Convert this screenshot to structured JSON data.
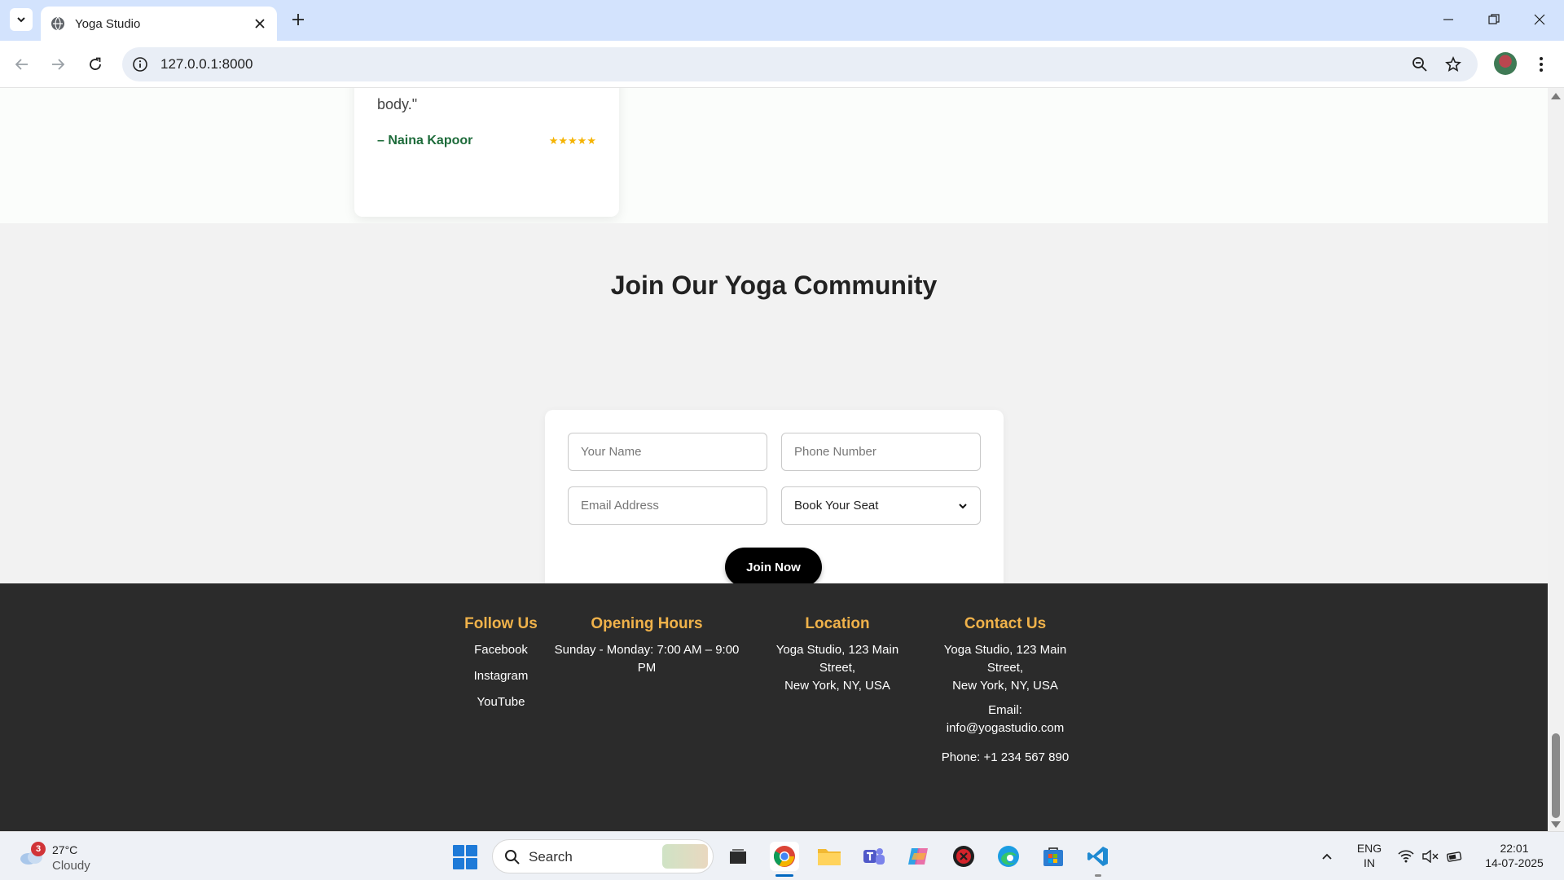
{
  "browser": {
    "tab_title": "Yoga Studio",
    "url": "127.0.0.1:8000"
  },
  "testimonial": {
    "quote_tail": "body.\"",
    "author": "– Naina Kapoor",
    "stars": "★★★★★",
    "star_color": "#f5b301"
  },
  "join": {
    "title": "Join Our Yoga Community",
    "name_placeholder": "Your Name",
    "phone_placeholder": "Phone Number",
    "email_placeholder": "Email Address",
    "seat_selected": "Book Your Seat",
    "button_label": "Join Now"
  },
  "footer": {
    "follow": {
      "title": "Follow Us",
      "links": [
        "Facebook",
        "Instagram",
        "YouTube"
      ]
    },
    "hours": {
      "title": "Opening Hours",
      "text": "Sunday - Monday: 7:00 AM – 9:00 PM"
    },
    "location": {
      "title": "Location",
      "line1": "Yoga Studio, 123 Main Street,",
      "line2": "New York, NY, USA"
    },
    "contact": {
      "title": "Contact Us",
      "line1": "Yoga Studio, 123 Main Street,",
      "line2": "New York, NY, USA",
      "email_label": "Email:",
      "email": "info@yogastudio.com",
      "phone": "Phone: +1 234 567 890"
    },
    "heading_color": "#f0b24a",
    "background": "#2b2b2b"
  },
  "taskbar": {
    "weather_badge": "3",
    "temperature": "27°C",
    "condition": "Cloudy",
    "search_label": "Search",
    "lang_line1": "ENG",
    "lang_line2": "IN",
    "time": "22:01",
    "date": "14-07-2025"
  }
}
